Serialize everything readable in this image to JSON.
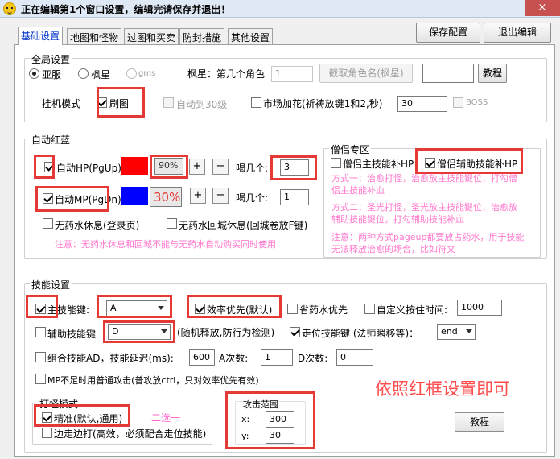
{
  "window": {
    "title": "正在编辑第1个窗口设置，编辑完请保存并退出！",
    "close": "×"
  },
  "tabs": [
    {
      "label": "基础设置",
      "active": true
    },
    {
      "label": "地图和怪物"
    },
    {
      "label": "过图和买卖"
    },
    {
      "label": "防封措施"
    },
    {
      "label": "其他设置"
    }
  ],
  "buttons": {
    "save": "保存配置",
    "exit": "退出编辑",
    "tutorial1": "教程",
    "tutorial2": "教程",
    "fetch_name": "截取角色名(枫星)",
    "plus": "+",
    "minus": "−"
  },
  "global": {
    "title": "全局设置",
    "server_yafu": "亚服",
    "server_fengxing": "枫星",
    "server_gms": "gms",
    "fengxing_role_label": "枫星：第几个角色",
    "role_index": "1",
    "role_name": "",
    "hang_mode_label": "挂机模式",
    "brush_map": "刷图",
    "auto_30": "自动到30级",
    "market_flower": "市场加花(祈祷放键1和2,秒)",
    "market_seconds": "30",
    "boss": "BOSS"
  },
  "auto_potion": {
    "title": "自动红蓝",
    "auto_hp": "自动HP(PgUp)",
    "hp_percent": "90%",
    "auto_mp": "自动MP(PgDn)",
    "mp_percent": "30%",
    "drink_label": "喝几个:",
    "hp_count": "3",
    "mp_count": "1",
    "no_potion_rest": "无药水休息(登录页)",
    "no_potion_town": "无药水回城休息(回城卷放F键)",
    "note": "注意：无药水休息和回城不能与无药水自动购买同时使用",
    "colors": {
      "hp": "#ff0000",
      "mp": "#0000ff"
    }
  },
  "priest": {
    "title": "僧侣专区",
    "main_skill_hp": "僧侣主技能补HP",
    "assist_skill_hp": "僧侣辅助技能补HP",
    "method1": [
      "方式一：治愈打怪，治愈放主技能键位，打勾僧",
      "侣主技能补血"
    ],
    "method2": [
      "方式二：圣光打怪，圣光放主技能键位，治愈放",
      "辅助技能键位，打勾辅助技能补血"
    ],
    "method3": [
      "注意：两种方式pageup都要放占药水，用于技能",
      "无法释放治愈的场合，比如符文"
    ]
  },
  "skill": {
    "title": "技能设置",
    "main_key_label": "主技能键:",
    "main_key": "A",
    "efficiency": "效率优先(默认)",
    "save_potion": "省药水优先",
    "custom_interval": "自定义按住时间:",
    "interval": "1000",
    "assist_key_label": "辅助技能键",
    "assist_key": "D",
    "random_note": "(随机释放,防行为检测)",
    "move_skill": "走位技能键 (法师瞬移等)：",
    "move_key": "end",
    "combo": "组合技能AD，技能延迟(ms):",
    "combo_delay": "600",
    "a_times_label": "A次数:",
    "a_times": "1",
    "d_times_label": "D次数:",
    "d_times": "0",
    "mp_normal": "MP不足时用普通攻击(普攻放ctrl，只对效率优先有效)",
    "hint": "依照红框设置即可"
  },
  "attack_mode": {
    "title": "打怪模式",
    "precise": "精准(默认,通用)",
    "choose_one": "二选一",
    "edge": "边走边打(高效，必须配合走位技能)"
  },
  "attack_range": {
    "title": "攻击范围",
    "x_label": "x:",
    "x": "300",
    "y_label": "y:",
    "y": "30"
  },
  "colors": {
    "highlight": "#e53935",
    "note": "#ff66cc",
    "title_bar": "#dfe9f5"
  }
}
